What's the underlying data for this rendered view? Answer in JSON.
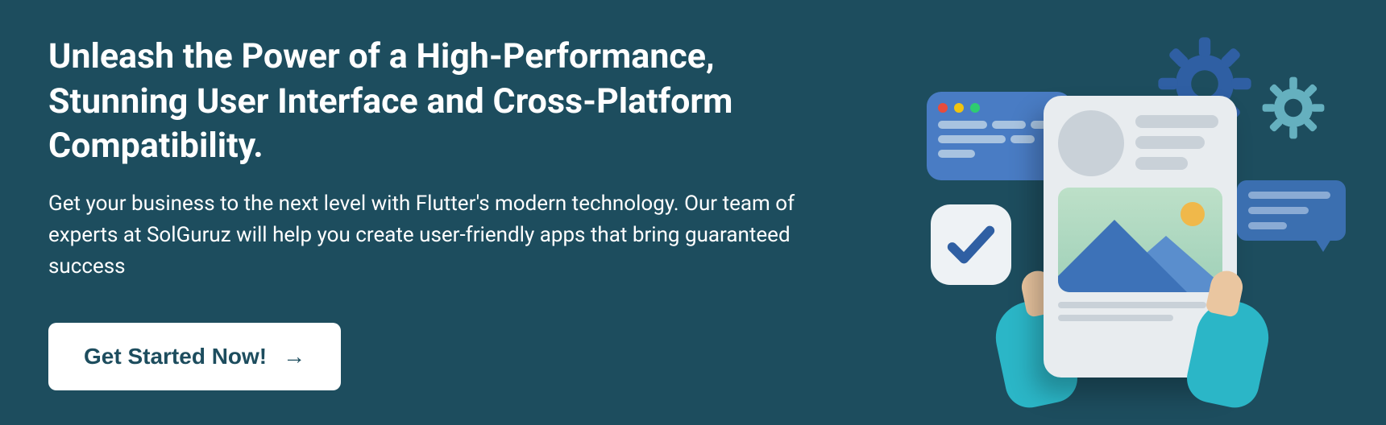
{
  "hero": {
    "heading": "Unleash the Power of a High-Performance, Stunning User Interface and Cross-Platform Compatibility.",
    "subheading": "Get your business to the next level with Flutter's modern technology. Our team of experts at SolGuruz will help you create user-friendly apps that bring guaranteed success",
    "cta_label": "Get Started Now!"
  },
  "colors": {
    "background": "#1d4d5e",
    "button_bg": "#ffffff",
    "button_text": "#1d4d5e",
    "accent_blue": "#497cc4",
    "accent_teal": "#2bb6c7"
  },
  "illustration": {
    "gear_large_icon": "gear-icon",
    "gear_small_icon": "gear-icon",
    "window_icon": "app-window-icon",
    "check_icon": "checkmark-icon",
    "chat_icon": "chat-bubble-icon",
    "image_icon": "image-placeholder-icon"
  }
}
